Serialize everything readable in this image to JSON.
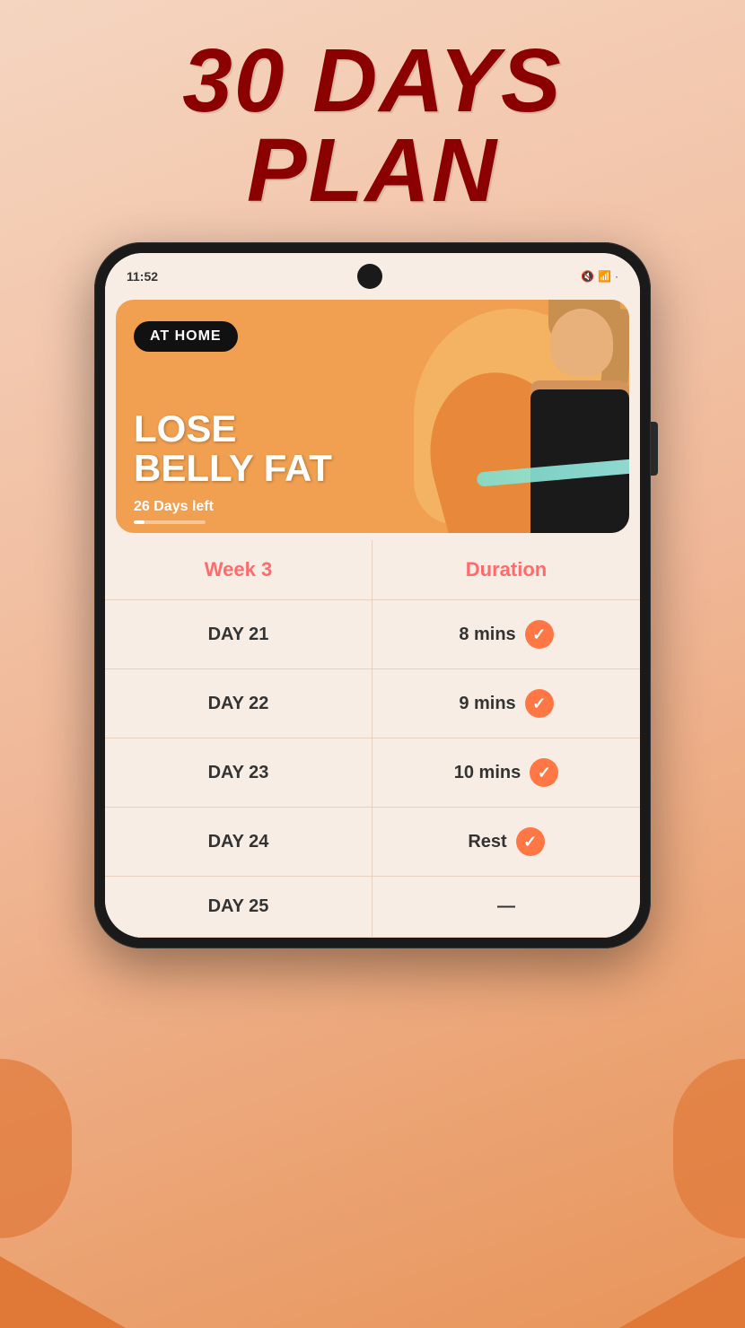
{
  "page": {
    "title_line1": "30 DAYS",
    "title_line2": "PLAN",
    "title_color": "#8B0000"
  },
  "status_bar": {
    "time": "11:52",
    "icons": "🔕 📶 ·"
  },
  "banner": {
    "label": "AT HOME",
    "title_line1": "LOSE",
    "title_line2": "BELLY FAT",
    "days_left": "26 Days left"
  },
  "table": {
    "col1_header": "Week 3",
    "col2_header": "Duration",
    "rows": [
      {
        "day": "DAY 21",
        "duration": "8 mins",
        "completed": true
      },
      {
        "day": "DAY 22",
        "duration": "9 mins",
        "completed": true
      },
      {
        "day": "DAY 23",
        "duration": "10 mins",
        "completed": true
      },
      {
        "day": "DAY 24",
        "duration": "Rest",
        "completed": true
      },
      {
        "day": "DAY 25",
        "duration": "...",
        "completed": false
      }
    ]
  },
  "colors": {
    "accent": "#ff7744",
    "header_text": "#ff6b6b",
    "dark_red": "#8B0000",
    "banner_bg": "#f0a050"
  }
}
